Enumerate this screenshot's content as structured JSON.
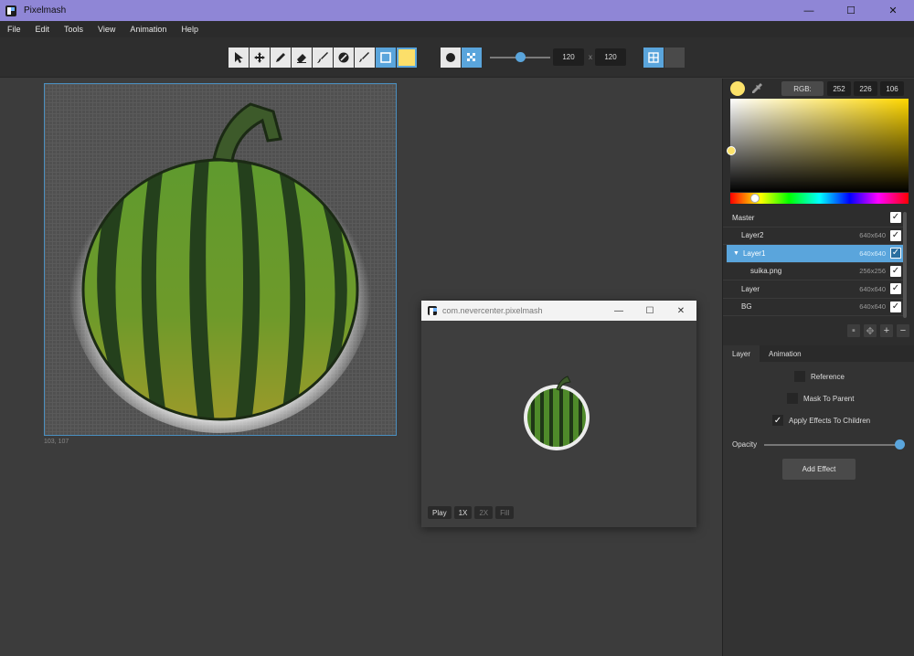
{
  "window": {
    "title": "Pixelmash",
    "minimize": "—",
    "maximize": "☐",
    "close": "✕"
  },
  "menu": [
    "File",
    "Edit",
    "Tools",
    "View",
    "Animation",
    "Help"
  ],
  "toolbar": {
    "brush_size_value": 0.5,
    "width": "120",
    "height": "120",
    "separator": "x"
  },
  "canvas": {
    "cursor_coords": "103, 107"
  },
  "preview": {
    "title": "com.nevercenter.pixelmash",
    "minimize": "—",
    "maximize": "☐",
    "close": "✕",
    "buttons": [
      "Play",
      "1X",
      "2X",
      "Fill"
    ]
  },
  "color": {
    "mode_label": "RGB:",
    "r": "252",
    "g": "226",
    "b": "106",
    "current": "#fce26a"
  },
  "layers": [
    {
      "name": "Master",
      "size": "",
      "indent": 0,
      "selected": false
    },
    {
      "name": "Layer2",
      "size": "640x640",
      "indent": 1,
      "selected": false
    },
    {
      "name": "Layer1",
      "size": "640x640",
      "indent": 1,
      "selected": true,
      "expanded": true
    },
    {
      "name": "suika.png",
      "size": "256x256",
      "indent": 2,
      "selected": false
    },
    {
      "name": "Layer",
      "size": "640x640",
      "indent": 1,
      "selected": false
    },
    {
      "name": "BG",
      "size": "640x640",
      "indent": 1,
      "selected": false
    }
  ],
  "tabs": {
    "layer": "Layer",
    "animation": "Animation"
  },
  "props": {
    "reference": "Reference",
    "mask_to_parent": "Mask To Parent",
    "apply_effects": "Apply Effects To Children",
    "opacity_label": "Opacity",
    "opacity_value": 1.0,
    "add_effect": "Add Effect"
  }
}
